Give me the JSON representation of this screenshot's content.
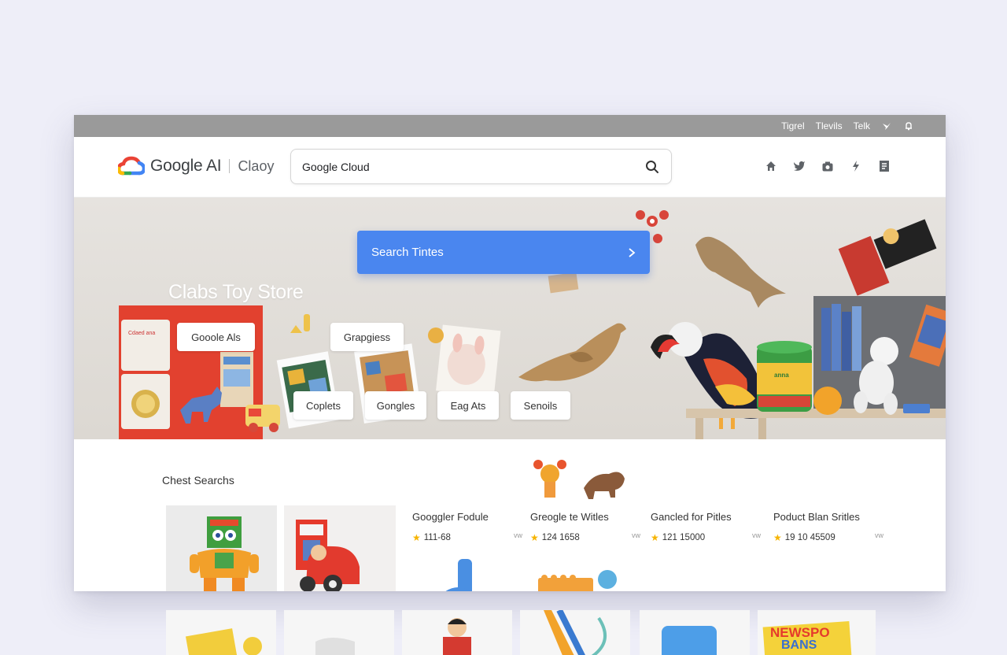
{
  "topbar": {
    "links": [
      "Tigrel",
      "Tlevils",
      "Telk"
    ]
  },
  "header": {
    "brand_name": "Google AI",
    "product_name": "Claoy",
    "search_value": "Google Cloud",
    "icons": [
      "home-icon",
      "twitter-icon",
      "camera-icon",
      "bolt-icon",
      "document-icon"
    ]
  },
  "hero": {
    "cta_label": "Search Tintes",
    "title": "Clabs Toy Store",
    "chips": [
      "Gooole Als",
      "Grapgiess",
      "Coplets",
      "Gongles",
      "Eag Ats",
      "Senoils"
    ],
    "box_label": "Cdaed ana",
    "can_label": "anna"
  },
  "results": {
    "section_title": "Chest Searchs",
    "products": [
      {
        "title": "Googgler Fodule",
        "rating": "111-68",
        "more": "vw"
      },
      {
        "title": "Greogle te Witles",
        "rating": "124 1658",
        "more": "vw"
      },
      {
        "title": "Gancled for Pitles",
        "rating": "121 15000",
        "more": "vw"
      },
      {
        "title": "Poduct Blan Sritles",
        "rating": "19 10 45509",
        "more": "vw"
      }
    ],
    "sticker_text": [
      "NEWSPO",
      "BANS"
    ]
  },
  "colors": {
    "accent": "#4a86ef",
    "topbar": "#9a9a9a",
    "star": "#f6b400",
    "hero_bg": "#e2dfda",
    "page_bg": "#eeeef8"
  }
}
